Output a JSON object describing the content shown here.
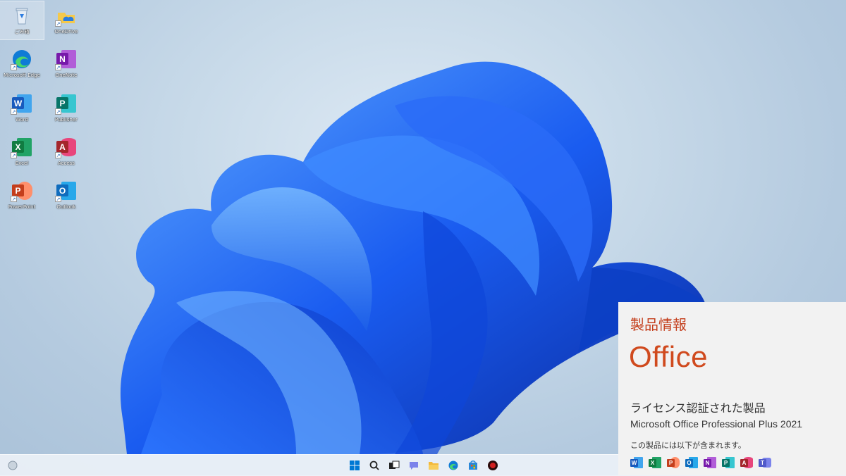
{
  "desktop": {
    "icons": [
      {
        "label": "ごみ箱",
        "name": "recycle-bin"
      },
      {
        "label": "OneDrive",
        "name": "onedrive"
      },
      {
        "label": "Microsoft Edge",
        "name": "microsoft-edge"
      },
      {
        "label": "OneNote",
        "name": "onenote"
      },
      {
        "label": "Word",
        "name": "word"
      },
      {
        "label": "Publisher",
        "name": "publisher"
      },
      {
        "label": "Excel",
        "name": "excel"
      },
      {
        "label": "Access",
        "name": "access"
      },
      {
        "label": "PowerPoint",
        "name": "powerpoint"
      },
      {
        "label": "Outlook",
        "name": "outlook"
      }
    ]
  },
  "taskbar": {
    "items": [
      "windows-start-icon",
      "search-icon",
      "task-view-icon",
      "chat-icon",
      "file-explorer-icon",
      "edge-icon",
      "store-icon",
      "app-icon"
    ]
  },
  "office_panel": {
    "heading": "製品情報",
    "logo_text": "Office",
    "license_status": "ライセンス認証された製品",
    "product_name": "Microsoft Office Professional Plus 2021",
    "includes_text": "この製品には以下が含まれます。",
    "apps": [
      {
        "letter": "W",
        "color": "#185abd"
      },
      {
        "letter": "X",
        "color": "#107c41"
      },
      {
        "letter": "P",
        "color": "#c43e1c"
      },
      {
        "letter": "O",
        "color": "#0f6cbd"
      },
      {
        "letter": "N",
        "color": "#7719aa"
      },
      {
        "letter": "P",
        "color": "#077568"
      },
      {
        "letter": "A",
        "color": "#a4262c"
      },
      {
        "letter": "T",
        "color": "#5059c9"
      }
    ]
  },
  "colors": {
    "accent_orange": "#d04a1e",
    "wallpaper_blue": "#1a5cf0"
  }
}
